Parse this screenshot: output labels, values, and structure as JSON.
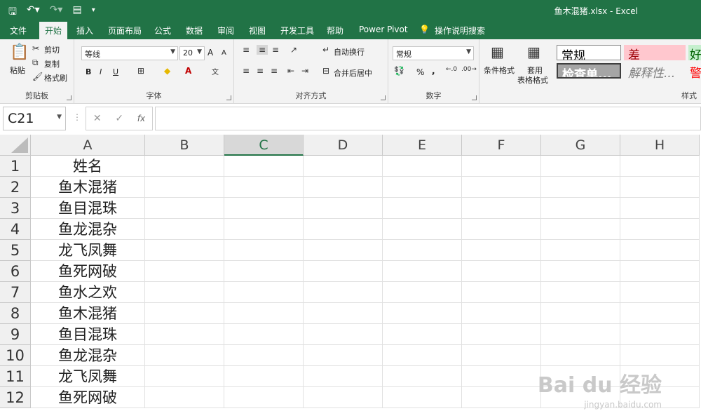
{
  "window_title": "鱼木混猪.xlsx - Excel",
  "tabs": [
    "文件",
    "开始",
    "插入",
    "页面布局",
    "公式",
    "数据",
    "审阅",
    "视图",
    "开发工具",
    "帮助",
    "Power Pivot",
    "操作说明搜索"
  ],
  "ribbon": {
    "clipboard": {
      "paste": "粘贴",
      "cut": "剪切",
      "copy": "复制",
      "format_painter": "格式刷",
      "label": "剪贴板"
    },
    "font": {
      "font_name": "等线",
      "font_size": "20",
      "grow": "A",
      "shrink": "A",
      "bold": "B",
      "italic": "I",
      "underline": "U",
      "label": "字体"
    },
    "alignment": {
      "wrap": "自动换行",
      "merge": "合并后居中",
      "label": "对齐方式"
    },
    "number": {
      "format": "常规",
      "percent": "%",
      "comma": ",",
      "label": "数字"
    },
    "styles": {
      "conditional": "条件格式",
      "table_format_1": "套用",
      "table_format_2": "表格格式",
      "normal": "常规",
      "bad": "差",
      "good": "好",
      "check_cell": "检查单...",
      "explanatory": "解释性...",
      "warn": "警",
      "label": "样式"
    }
  },
  "name_box": "C21",
  "fx": "fx",
  "columns": [
    "A",
    "B",
    "C",
    "D",
    "E",
    "F",
    "G",
    "H"
  ],
  "selected_column": "C",
  "rows": [
    {
      "num": "1",
      "a": "姓名"
    },
    {
      "num": "2",
      "a": "鱼木混猪"
    },
    {
      "num": "3",
      "a": "鱼目混珠"
    },
    {
      "num": "4",
      "a": "鱼龙混杂"
    },
    {
      "num": "5",
      "a": "龙飞凤舞"
    },
    {
      "num": "6",
      "a": "鱼死网破"
    },
    {
      "num": "7",
      "a": "鱼水之欢"
    },
    {
      "num": "8",
      "a": "鱼木混猪"
    },
    {
      "num": "9",
      "a": "鱼目混珠"
    },
    {
      "num": "10",
      "a": "鱼龙混杂"
    },
    {
      "num": "11",
      "a": "龙飞凤舞"
    },
    {
      "num": "12",
      "a": "鱼死网破"
    }
  ],
  "watermark": {
    "main": "Bai du 经验",
    "sub": "jingyan.baidu.com"
  },
  "colors": {
    "accent": "#217346",
    "bad_bg": "#ffc7ce",
    "bad_fg": "#9c0006",
    "good_bg": "#c6efce"
  }
}
